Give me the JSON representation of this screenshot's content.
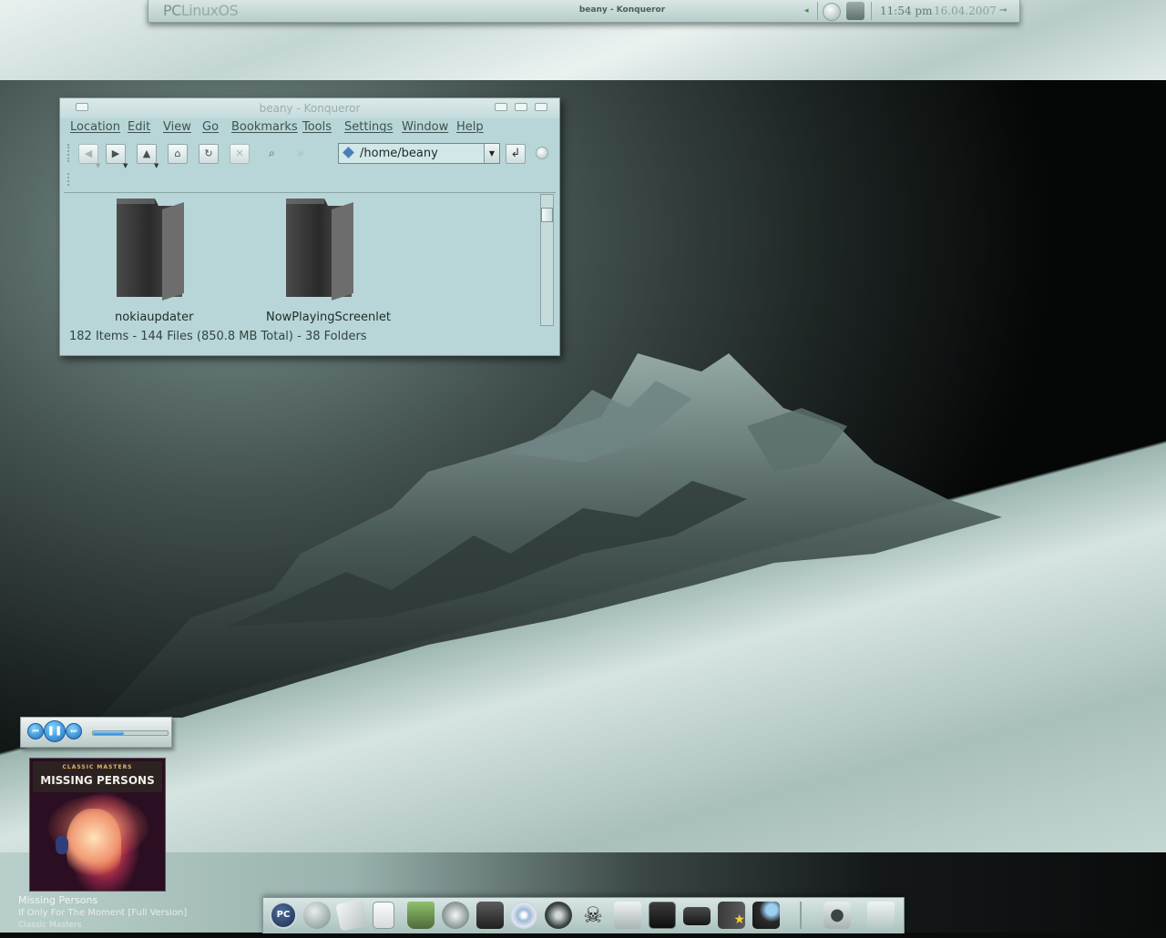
{
  "top_panel": {
    "brand_pc": "PC",
    "brand_os": "LinuxOS",
    "task_title": "beany - Konqueror",
    "clock_time": "11:54 pm",
    "clock_date": "16.04.2007",
    "icons": [
      "volume-icon",
      "mixer-icon",
      "lock-icon",
      "tray-arrow-icon"
    ]
  },
  "window": {
    "title": "beany - Konqueror",
    "menu": [
      "Location",
      "Edit",
      "View",
      "Go",
      "Bookmarks",
      "Tools",
      "Settings",
      "Window",
      "Help"
    ],
    "toolbar_icons": [
      "back-icon",
      "forward-icon",
      "up-icon",
      "home-icon",
      "reload-icon",
      "stop-icon",
      "zoom-out-icon",
      "zoom-in-icon"
    ],
    "location": "/home/beany",
    "folders": [
      {
        "name": "nokiaupdater"
      },
      {
        "name": "NowPlayingScreenlet"
      }
    ],
    "status": "182 Items - 144 Files (850.8 MB Total) - 38 Folders"
  },
  "player": {
    "progress": 0.42,
    "controls": [
      "previous-icon",
      "pause-icon",
      "next-icon"
    ]
  },
  "now_playing": {
    "cover_series": "CLASSIC MASTERS",
    "cover_title": "MISSING PERSONS",
    "artist": "Missing Persons",
    "title": "If Only For The Moment [Full Version]",
    "album": "Classic Masters"
  },
  "dock": {
    "launcher_label": "PC",
    "icons": [
      "pclinuxos-launcher-icon",
      "network-globe-icon",
      "mail-icon",
      "document-icon",
      "pencil-cup-icon",
      "firefox-icon",
      "clapperboard-icon",
      "media-disc-icon",
      "safari-compass-icon",
      "skull-crossbones-icon",
      "camera-icon",
      "terminal-icon",
      "disk-drive-icon",
      "favorites-star-icon",
      "network-monitor-icon",
      "apple-logo-icon",
      "trash-icon"
    ]
  }
}
